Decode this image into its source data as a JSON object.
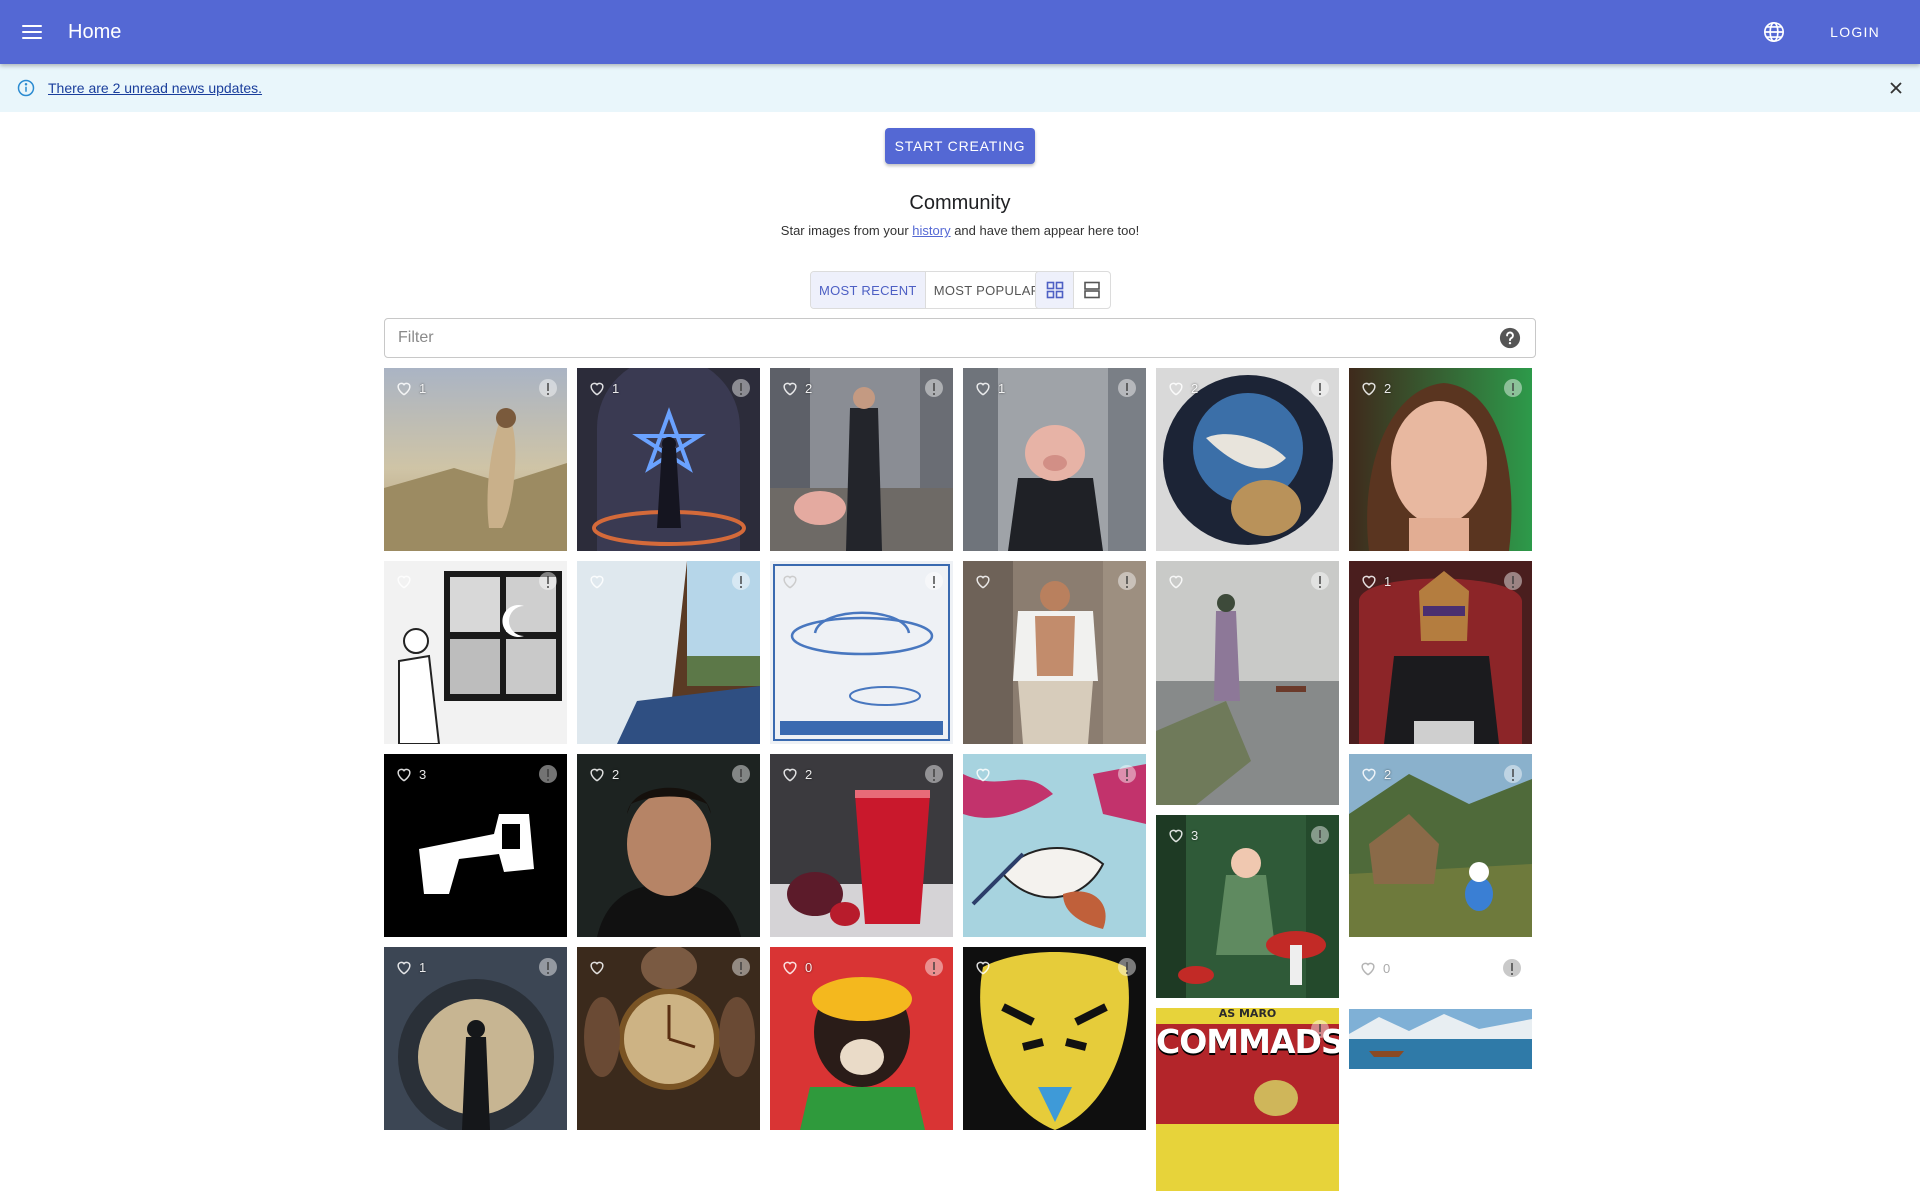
{
  "appbar": {
    "title": "Home",
    "login_label": "LOGIN",
    "color": "#5468d4"
  },
  "news": {
    "text": "There are 2 unread news updates."
  },
  "start_label": "START CREATING",
  "community": {
    "title": "Community",
    "sub_before": "Star images from your ",
    "sub_link": "history",
    "sub_after": " and have them appear here too!"
  },
  "sort": {
    "recent": "MOST RECENT",
    "popular": "MOST POPULAR"
  },
  "filter": {
    "placeholder": "Filter",
    "value": ""
  },
  "gallery": [
    {
      "name": "girl-in-field",
      "likes": "1"
    },
    {
      "name": "star-portal",
      "likes": "1"
    },
    {
      "name": "man-with-pig",
      "likes": "2"
    },
    {
      "name": "pig-in-suit",
      "likes": "1"
    },
    {
      "name": "astronaut-cats",
      "likes": "2"
    },
    {
      "name": "woman-portrait",
      "likes": "2"
    },
    {
      "name": "boy-at-window",
      "likes": ""
    },
    {
      "name": "sunlit-window",
      "likes": ""
    },
    {
      "name": "ufo-blueprint",
      "likes": ""
    },
    {
      "name": "man-in-street",
      "likes": ""
    },
    {
      "name": "figure-by-lake",
      "likes": ""
    },
    {
      "name": "dog-in-chair",
      "likes": "1"
    },
    {
      "name": "stencil-gun",
      "likes": "3"
    },
    {
      "name": "young-man-portrait",
      "likes": "2"
    },
    {
      "name": "red-drink",
      "likes": "2"
    },
    {
      "name": "bird-pattern",
      "likes": ""
    },
    {
      "name": "fairy-mushrooms",
      "likes": "3"
    },
    {
      "name": "smurf-village",
      "likes": "2"
    },
    {
      "name": "stargate-figure",
      "likes": "1"
    },
    {
      "name": "clock-group",
      "likes": ""
    },
    {
      "name": "cartoon-dog",
      "likes": "0"
    },
    {
      "name": "leopard-face",
      "likes": ""
    },
    {
      "name": "commads-poster",
      "likes": ""
    },
    {
      "name": "lake-canoe",
      "likes": ""
    }
  ],
  "poster_text": {
    "small": "AS MARO",
    "big": "COMMADS"
  },
  "empty_card": {
    "likes": "0"
  }
}
